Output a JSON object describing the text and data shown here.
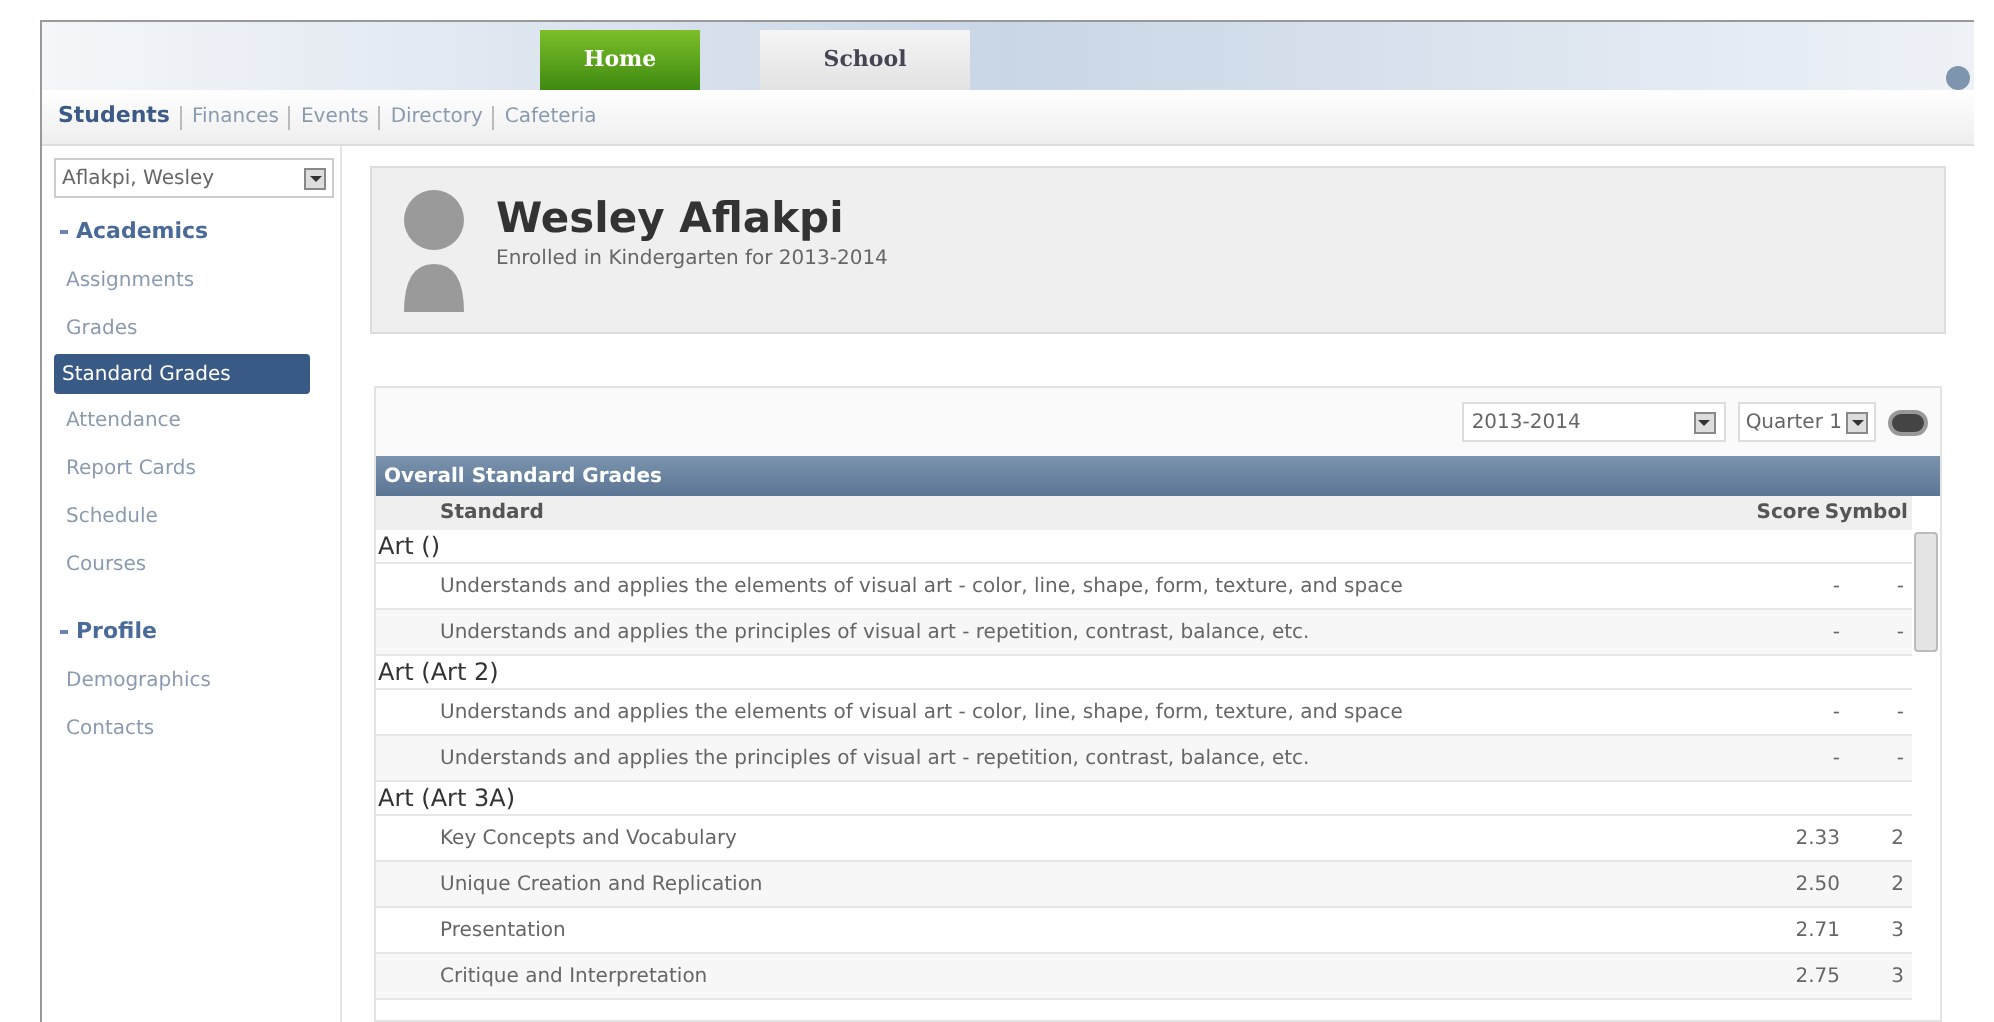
{
  "top_tabs": [
    {
      "label": "Home",
      "selected": true
    },
    {
      "label": "School",
      "selected": false
    }
  ],
  "subnav": [
    {
      "label": "Students",
      "selected": true
    },
    {
      "label": "Finances",
      "selected": false
    },
    {
      "label": "Events",
      "selected": false
    },
    {
      "label": "Directory",
      "selected": false
    },
    {
      "label": "Cafeteria",
      "selected": false
    }
  ],
  "student_select": {
    "value": "Aflakpi, Wesley"
  },
  "sidebar": [
    {
      "title": "Academics",
      "expanded": true,
      "items": [
        {
          "label": "Assignments",
          "selected": false
        },
        {
          "label": "Grades",
          "selected": false
        },
        {
          "label": "Standard Grades",
          "selected": true
        },
        {
          "label": "Attendance",
          "selected": false
        },
        {
          "label": "Report Cards",
          "selected": false
        },
        {
          "label": "Schedule",
          "selected": false
        },
        {
          "label": "Courses",
          "selected": false
        }
      ]
    },
    {
      "title": "Profile",
      "expanded": true,
      "items": [
        {
          "label": "Demographics",
          "selected": false
        },
        {
          "label": "Contacts",
          "selected": false
        }
      ]
    }
  ],
  "student": {
    "name": "Wesley Aflakpi",
    "enrollment": "Enrolled in Kindergarten for 2013-2014"
  },
  "filters": {
    "year": "2013-2014",
    "quarter": "Quarter 1"
  },
  "grades": {
    "title": "Overall Standard Grades",
    "columns": [
      "Standard",
      "Score",
      "Symbol"
    ],
    "groups": [
      {
        "name": "Art ()",
        "rows": [
          {
            "standard": "Understands and applies the elements of visual art - color, line, shape, form, texture, and space",
            "score": "-",
            "symbol": "-"
          },
          {
            "standard": "Understands and applies the principles of visual art - repetition, contrast, balance, etc.",
            "score": "-",
            "symbol": "-"
          }
        ]
      },
      {
        "name": "Art (Art 2)",
        "rows": [
          {
            "standard": "Understands and applies the elements of visual art - color, line, shape, form, texture, and space",
            "score": "-",
            "symbol": "-"
          },
          {
            "standard": "Understands and applies the principles of visual art - repetition, contrast, balance, etc.",
            "score": "-",
            "symbol": "-"
          }
        ]
      },
      {
        "name": "Art (Art 3A)",
        "rows": [
          {
            "standard": "Key Concepts and Vocabulary",
            "score": "2.33",
            "symbol": "2"
          },
          {
            "standard": "Unique Creation and Replication",
            "score": "2.50",
            "symbol": "2"
          },
          {
            "standard": "Presentation",
            "score": "2.71",
            "symbol": "3"
          },
          {
            "standard": "Critique and Interpretation",
            "score": "2.75",
            "symbol": "3"
          }
        ]
      }
    ]
  }
}
